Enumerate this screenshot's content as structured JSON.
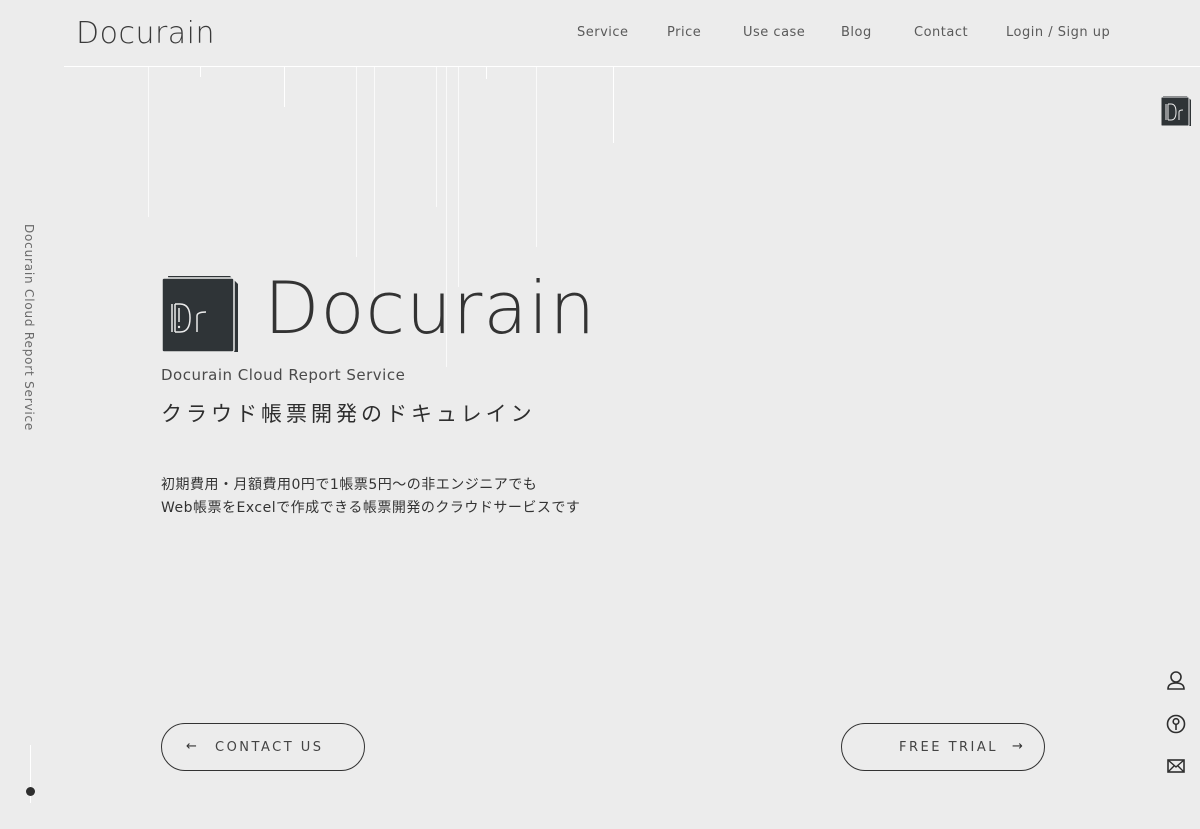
{
  "header": {
    "logo": "Docurain",
    "nav": [
      {
        "label": "Service"
      },
      {
        "label": "Price"
      },
      {
        "label": "Use case"
      },
      {
        "label": "Blog"
      },
      {
        "label": "Contact"
      },
      {
        "label": "Login / Sign up"
      }
    ]
  },
  "side": {
    "vertical_text": "Docurain Cloud Report Service",
    "icons": [
      "user-icon",
      "key-icon",
      "mail-icon"
    ]
  },
  "hero": {
    "logo_mark_text": "Dr",
    "wordmark": "Docurain",
    "subtitle": "Docurain Cloud Report Service",
    "tagline": "クラウド帳票開発のドキュレイン",
    "description": [
      "初期費用・月額費用0円で1帳票5円〜の非エンジニアでも",
      "Web帳票をExcelで作成できる帳票開発のクラウドサービスです"
    ]
  },
  "buttons": {
    "contact": {
      "label": "CONTACT US",
      "arrow": "←"
    },
    "trial": {
      "label": "FREE TRIAL",
      "arrow": "→"
    }
  },
  "colors": {
    "background": "#ececec",
    "text": "#2e2e2e",
    "accent_dark": "#2f3437"
  }
}
